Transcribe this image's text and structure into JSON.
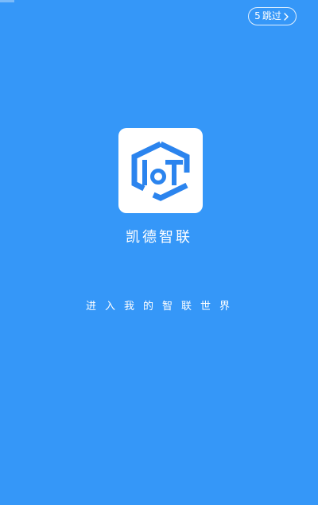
{
  "skip": {
    "countdown": "5",
    "label": "跳过",
    "icon": "chevron-right-icon"
  },
  "logo": {
    "icon": "iot-hexagon-logo",
    "text": "IoT",
    "color": "#2b84ee"
  },
  "app_name": "凯德智联",
  "slogan": "进入我的智联世界",
  "colors": {
    "background": "#3597f8",
    "tile": "#ffffff",
    "text": "#ffffff"
  }
}
